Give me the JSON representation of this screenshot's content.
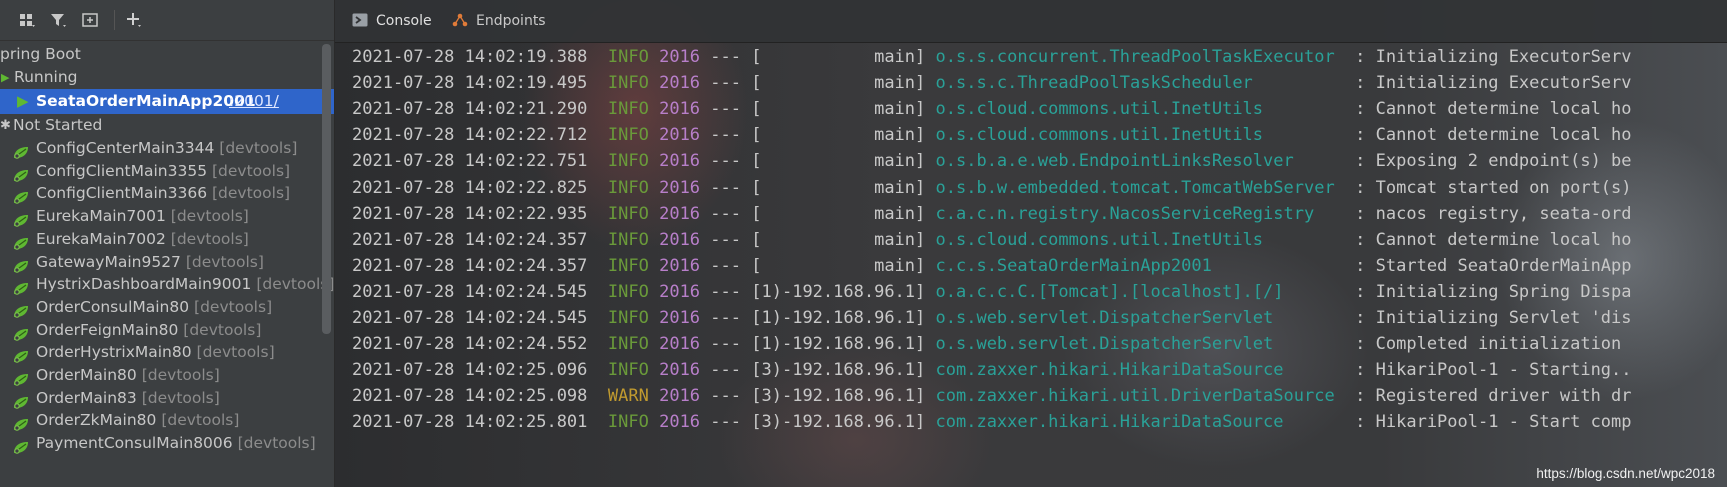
{
  "services": {
    "root_label": "pring Boot",
    "running_label": "Running",
    "selected_app": {
      "name": "SeataOrderMainApp2001",
      "port": ":2001/"
    },
    "not_started_label": "Not Started",
    "devtools_suffix": "[devtools]",
    "apps": [
      "ConfigCenterMain3344",
      "ConfigClientMain3355",
      "ConfigClientMain3366",
      "EurekaMain7001",
      "EurekaMain7002",
      "GatewayMain9527",
      "HystrixDashboardMain9001",
      "OrderConsulMain80",
      "OrderFeignMain80",
      "OrderHystrixMain80",
      "OrderMain80",
      "OrderMain83",
      "OrderZkMain80",
      "PaymentConsulMain8006"
    ]
  },
  "console_tabs": {
    "console": "Console",
    "endpoints": "Endpoints"
  },
  "log_lines": [
    {
      "ts": "2021-07-28 14:02:19.388",
      "level": "INFO",
      "pid": "2016",
      "sep": "---",
      "thread": "[           main]",
      "logger": "o.s.s.concurrent.ThreadPoolTaskExecutor ",
      "msg": ": Initializing ExecutorServ"
    },
    {
      "ts": "2021-07-28 14:02:19.495",
      "level": "INFO",
      "pid": "2016",
      "sep": "---",
      "thread": "[           main]",
      "logger": "o.s.s.c.ThreadPoolTaskScheduler         ",
      "msg": ": Initializing ExecutorServ"
    },
    {
      "ts": "2021-07-28 14:02:21.290",
      "level": "INFO",
      "pid": "2016",
      "sep": "---",
      "thread": "[           main]",
      "logger": "o.s.cloud.commons.util.InetUtils        ",
      "msg": ": Cannot determine local ho"
    },
    {
      "ts": "2021-07-28 14:02:22.712",
      "level": "INFO",
      "pid": "2016",
      "sep": "---",
      "thread": "[           main]",
      "logger": "o.s.cloud.commons.util.InetUtils        ",
      "msg": ": Cannot determine local ho"
    },
    {
      "ts": "2021-07-28 14:02:22.751",
      "level": "INFO",
      "pid": "2016",
      "sep": "---",
      "thread": "[           main]",
      "logger": "o.s.b.a.e.web.EndpointLinksResolver     ",
      "msg": ": Exposing 2 endpoint(s) be"
    },
    {
      "ts": "2021-07-28 14:02:22.825",
      "level": "INFO",
      "pid": "2016",
      "sep": "---",
      "thread": "[           main]",
      "logger": "o.s.b.w.embedded.tomcat.TomcatWebServer ",
      "msg": ": Tomcat started on port(s)"
    },
    {
      "ts": "2021-07-28 14:02:22.935",
      "level": "INFO",
      "pid": "2016",
      "sep": "---",
      "thread": "[           main]",
      "logger": "c.a.c.n.registry.NacosServiceRegistry   ",
      "msg": ": nacos registry, seata-ord"
    },
    {
      "ts": "2021-07-28 14:02:24.357",
      "level": "INFO",
      "pid": "2016",
      "sep": "---",
      "thread": "[           main]",
      "logger": "o.s.cloud.commons.util.InetUtils        ",
      "msg": ": Cannot determine local ho"
    },
    {
      "ts": "2021-07-28 14:02:24.357",
      "level": "INFO",
      "pid": "2016",
      "sep": "---",
      "thread": "[           main]",
      "logger": "c.c.s.SeataOrderMainApp2001             ",
      "msg": ": Started SeataOrderMainApp"
    },
    {
      "ts": "2021-07-28 14:02:24.545",
      "level": "INFO",
      "pid": "2016",
      "sep": "---",
      "thread": "[1)-192.168.96.1]",
      "logger": "o.a.c.c.C.[Tomcat].[localhost].[/]      ",
      "msg": ": Initializing Spring Dispa"
    },
    {
      "ts": "2021-07-28 14:02:24.545",
      "level": "INFO",
      "pid": "2016",
      "sep": "---",
      "thread": "[1)-192.168.96.1]",
      "logger": "o.s.web.servlet.DispatcherServlet       ",
      "msg": ": Initializing Servlet 'dis"
    },
    {
      "ts": "2021-07-28 14:02:24.552",
      "level": "INFO",
      "pid": "2016",
      "sep": "---",
      "thread": "[1)-192.168.96.1]",
      "logger": "o.s.web.servlet.DispatcherServlet       ",
      "msg": ": Completed initialization "
    },
    {
      "ts": "2021-07-28 14:02:25.096",
      "level": "INFO",
      "pid": "2016",
      "sep": "---",
      "thread": "[3)-192.168.96.1]",
      "logger": "com.zaxxer.hikari.HikariDataSource      ",
      "msg": ": HikariPool-1 - Starting.."
    },
    {
      "ts": "2021-07-28 14:02:25.098",
      "level": "WARN",
      "pid": "2016",
      "sep": "---",
      "thread": "[3)-192.168.96.1]",
      "logger": "com.zaxxer.hikari.util.DriverDataSource ",
      "msg": ": Registered driver with dr"
    },
    {
      "ts": "2021-07-28 14:02:25.801",
      "level": "INFO",
      "pid": "2016",
      "sep": "---",
      "thread": "[3)-192.168.96.1]",
      "logger": "com.zaxxer.hikari.HikariDataSource      ",
      "msg": ": HikariPool-1 - Start comp"
    }
  ],
  "watermark": "https://blog.csdn.net/wpc2018",
  "colors": {
    "selection": "#2f65ca",
    "info": "#6a9a3a",
    "warn": "#c09a2f",
    "pid": "#b87fca",
    "logger": "#2aa198",
    "springboot_green": "#5fb832"
  },
  "icons": [
    "group-by-icon",
    "filter-icon",
    "new-group-icon",
    "add-icon",
    "run-triangle-icon",
    "spring-boot-leaf-icon",
    "console-icon",
    "endpoints-icon"
  ]
}
